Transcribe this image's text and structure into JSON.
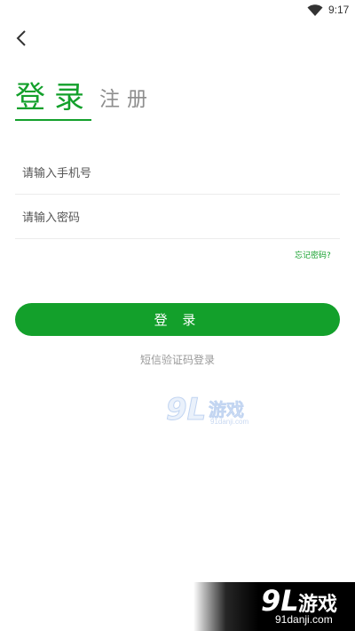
{
  "status_bar": {
    "time": "9:17",
    "wifi_icon": "wifi-icon"
  },
  "nav": {
    "back_icon": "chevron-left-icon"
  },
  "tabs": {
    "login": "登录",
    "register": "注册"
  },
  "form": {
    "phone_placeholder": "请输入手机号",
    "phone_value": "",
    "password_placeholder": "请输入密码",
    "password_value": "",
    "forgot_password": "忘记密码?",
    "login_button": "登 录",
    "sms_login": "短信验证码登录"
  },
  "watermarks": {
    "center": {
      "number": "9L",
      "text": "游戏",
      "domain": "91danji.com"
    },
    "corner": {
      "number": "9L",
      "text": "游戏",
      "domain": "91danji.com"
    }
  },
  "colors": {
    "accent": "#13a02b",
    "inactive_tab": "#8e8e8e",
    "divider": "#ececec"
  }
}
